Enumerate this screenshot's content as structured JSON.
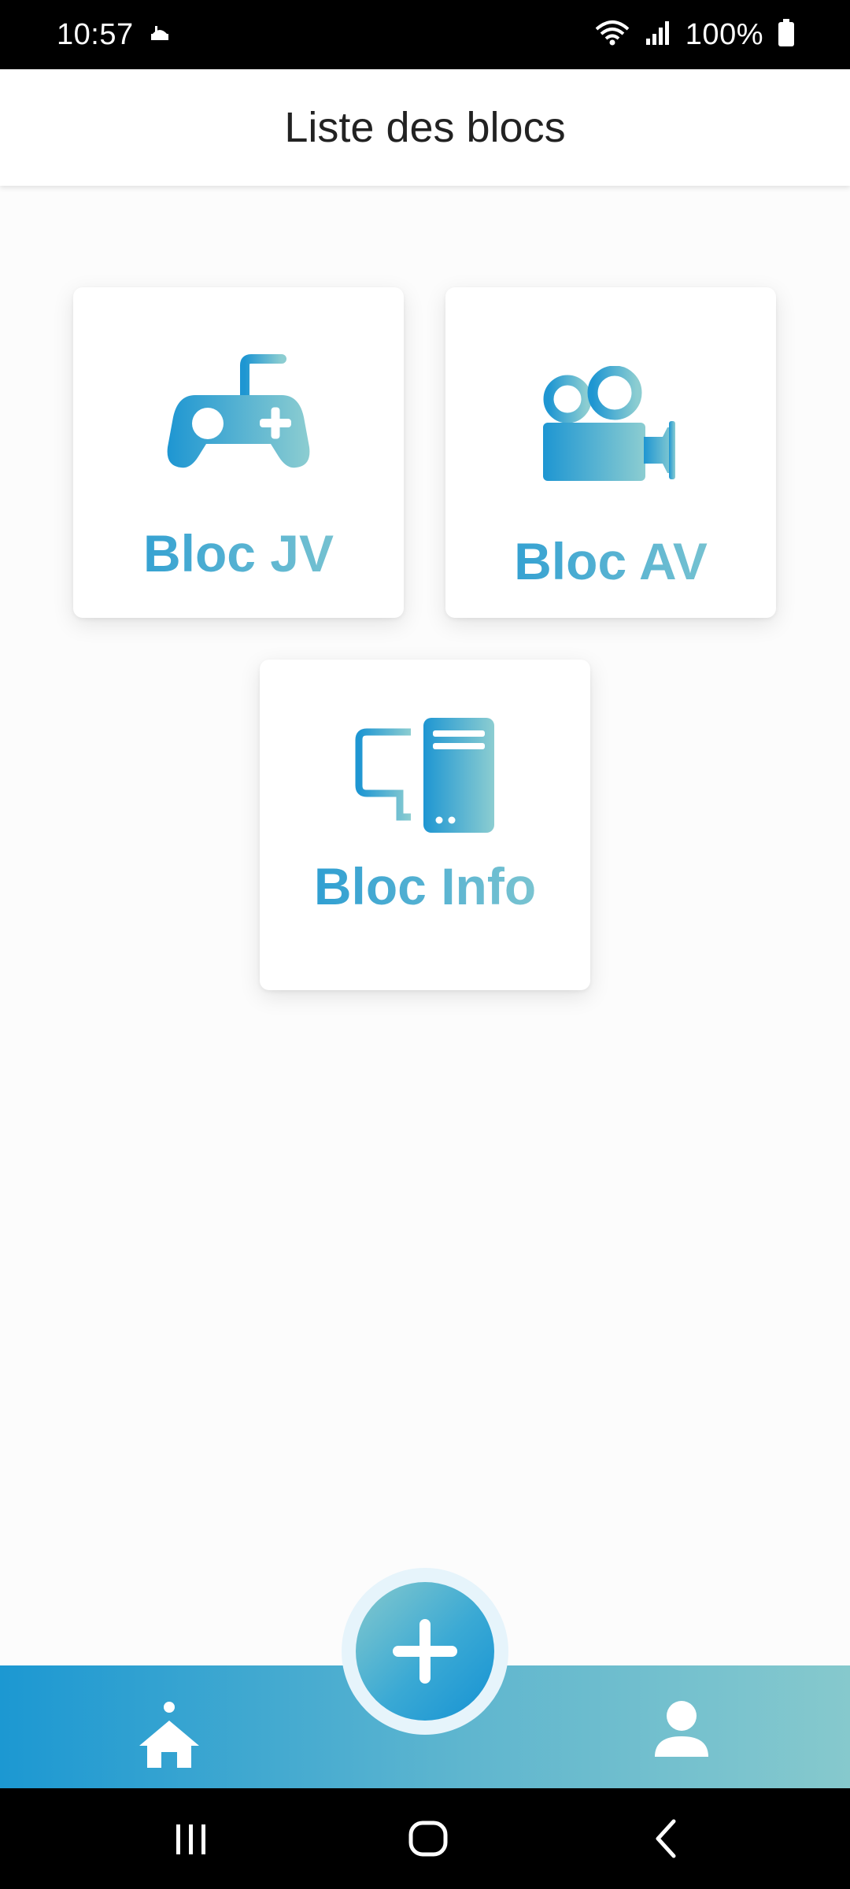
{
  "status_bar": {
    "time": "10:57",
    "battery": "100%",
    "icons": [
      "notification-icon",
      "wifi-icon",
      "signal-icon",
      "battery-icon"
    ]
  },
  "header": {
    "title": "Liste des blocs"
  },
  "blocks": [
    {
      "label": "Bloc JV",
      "icon": "gamepad-icon"
    },
    {
      "label": "Bloc AV",
      "icon": "video-camera-icon"
    },
    {
      "label": "Bloc Info",
      "icon": "computer-icon"
    }
  ],
  "bottom_nav": {
    "items": [
      {
        "name": "home",
        "icon": "home-icon",
        "active": true
      },
      {
        "name": "add",
        "icon": "plus-icon"
      },
      {
        "name": "profile",
        "icon": "user-icon"
      }
    ]
  },
  "system_nav": {
    "icons": [
      "recent-apps-icon",
      "home-button-icon",
      "back-icon"
    ]
  },
  "colors": {
    "gradient_start": "#1e96d2",
    "gradient_end": "#8ccdd1",
    "background": "#fcfcfc",
    "header_text": "#222222"
  }
}
